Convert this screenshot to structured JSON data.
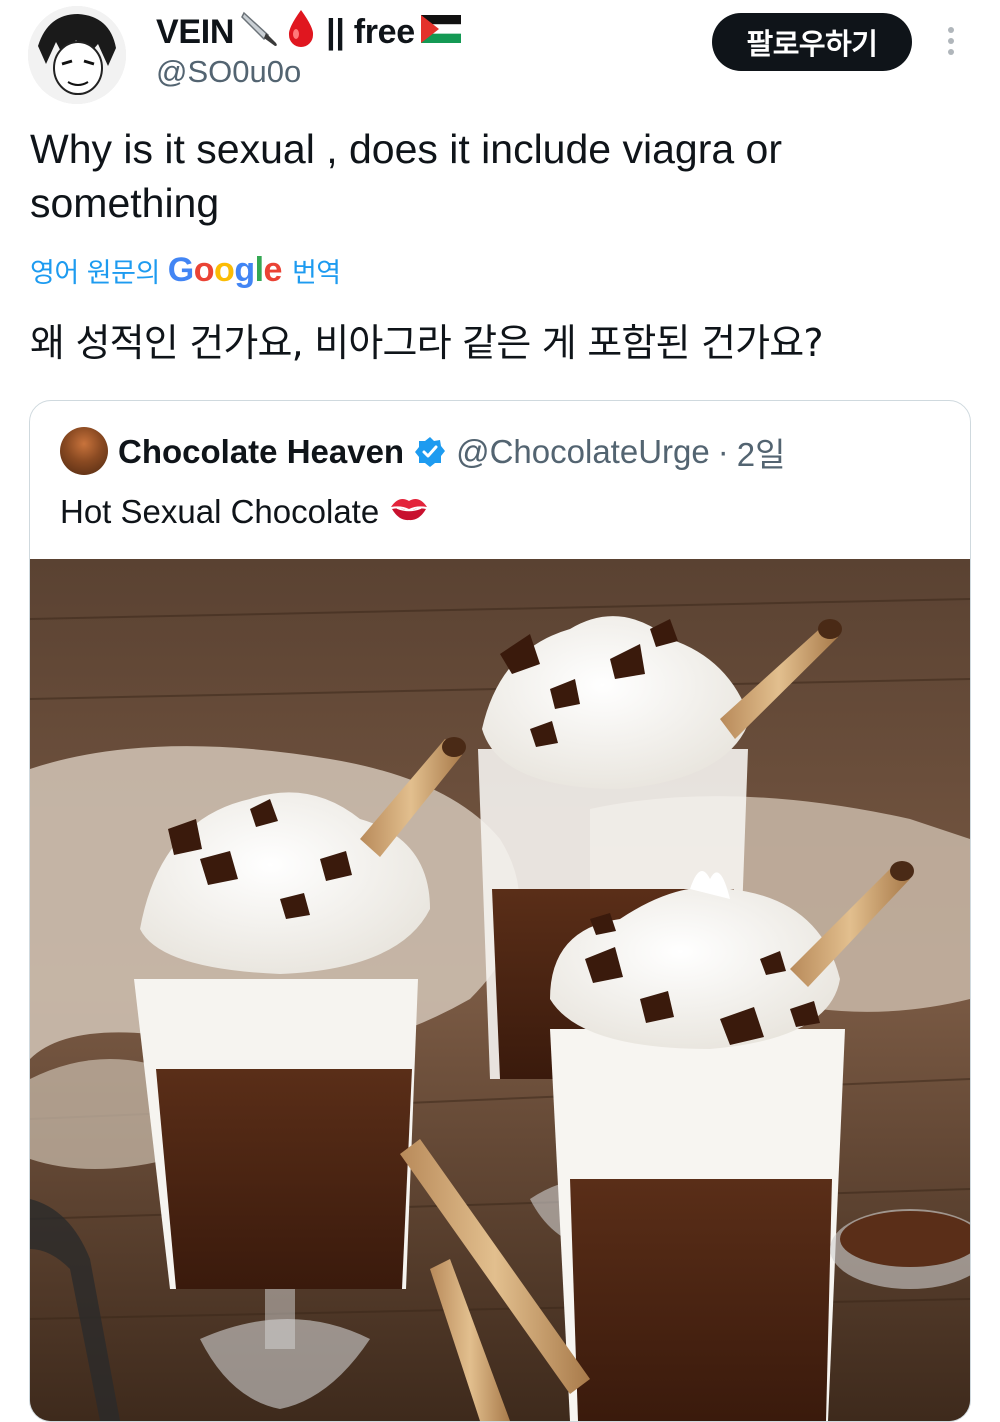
{
  "author": {
    "name": "VEIN",
    "name_suffix": "|| free",
    "handle": "@SO0u0o",
    "flag_icon": "palestine-flag-icon"
  },
  "actions": {
    "follow_label": "팔로우하기"
  },
  "tweet": {
    "text": "Why is it sexual , does it include viagra or something",
    "translate_prefix": "영어 원문의",
    "translate_brand": "Google",
    "translate_suffix": "번역",
    "translated_text": "왜 성적인 건가요, 비아그라 같은 게 포함된 건가요?"
  },
  "quoted": {
    "name": "Chocolate Heaven",
    "handle": "@ChocolateUrge",
    "separator": "·",
    "time": "2일",
    "text": "Hot Sexual Chocolate",
    "verified_color": "#1d9bf0"
  },
  "colors": {
    "link": "#1d9bf0",
    "secondary": "#536471",
    "follow_bg": "#0f1419"
  }
}
